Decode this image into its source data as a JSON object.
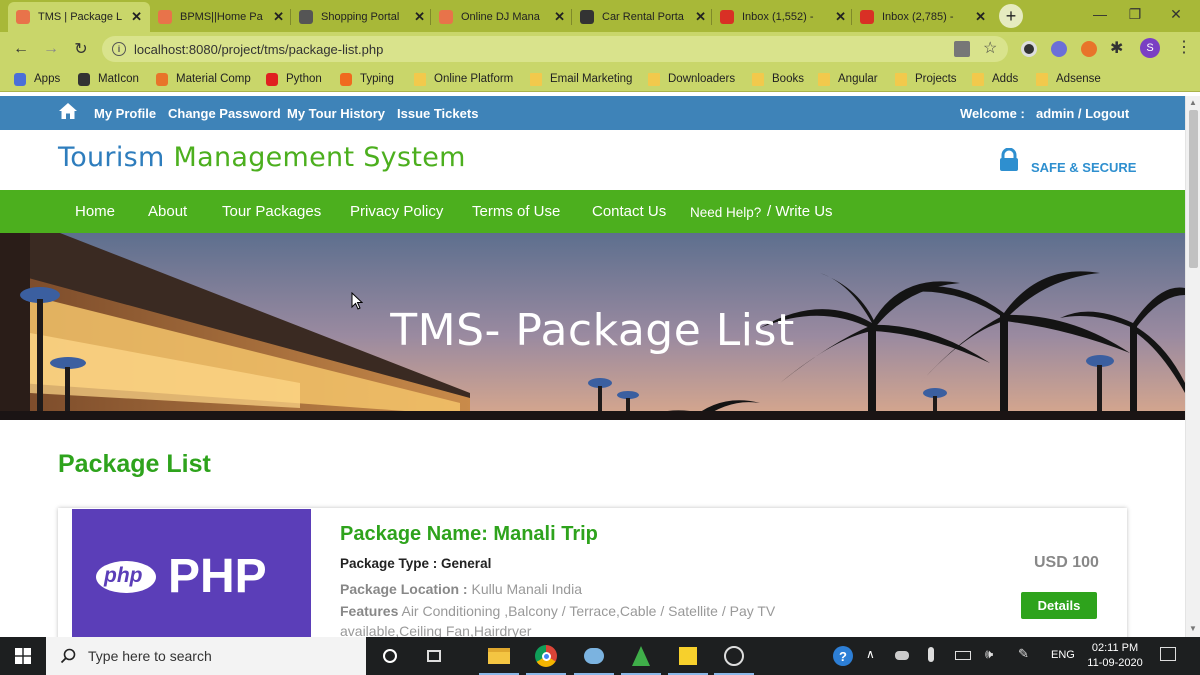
{
  "browser": {
    "tabs": [
      {
        "label": "TMS | Package L",
        "favicon_color": "#e8734a",
        "active": true
      },
      {
        "label": "BPMS||Home Pa",
        "favicon_color": "#e8734a",
        "active": false
      },
      {
        "label": "Shopping Portal",
        "favicon_color": "#555555",
        "active": false
      },
      {
        "label": "Online DJ Mana",
        "favicon_color": "#e8734a",
        "active": false
      },
      {
        "label": "Car Rental Porta",
        "favicon_color": "#333333",
        "active": false
      },
      {
        "label": "Inbox (1,552) -",
        "favicon_color": "#d93025",
        "active": false
      },
      {
        "label": "Inbox (2,785) -",
        "favicon_color": "#d93025",
        "active": false
      }
    ],
    "new_tab": "+",
    "url": "localhost:8080/project/tms/package-list.php",
    "profile_initial": "S",
    "bookmarks": [
      {
        "label": "Apps",
        "icon": "apps-grid-icon"
      },
      {
        "label": "MatIcon",
        "icon": "maticon-icon"
      },
      {
        "label": "Material Comp",
        "icon": "material-icon"
      },
      {
        "label": "Python",
        "icon": "youtube-icon"
      },
      {
        "label": "Typing",
        "icon": "typing-icon"
      },
      {
        "label": "Online Platform",
        "icon": "folder-icon"
      },
      {
        "label": "Email Marketing",
        "icon": "folder-icon"
      },
      {
        "label": "Downloaders",
        "icon": "folder-icon"
      },
      {
        "label": "Books",
        "icon": "folder-icon"
      },
      {
        "label": "Angular",
        "icon": "folder-icon"
      },
      {
        "label": "Projects",
        "icon": "folder-icon"
      },
      {
        "label": "Adds",
        "icon": "folder-icon"
      },
      {
        "label": "Adsense",
        "icon": "folder-icon"
      }
    ]
  },
  "site": {
    "topbar": {
      "links": [
        "My Profile",
        "Change Password",
        "My Tour History",
        "Issue Tickets"
      ],
      "welcome_label": "Welcome :",
      "user_link": "admin / Logout"
    },
    "brand_part1": "Tourism",
    "brand_part2": "Management System",
    "secure_label": "SAFE & SECURE",
    "nav": [
      "Home",
      "About",
      "Tour Packages",
      "Privacy Policy",
      "Terms of Use",
      "Contact Us"
    ],
    "help_label": "Need Help?",
    "write_us": "/ Write Us",
    "banner_title": "TMS- Package List",
    "section_heading": "Package List",
    "package": {
      "image_text": "PHP",
      "image_badge": "php",
      "name": "Package Name: Manali Trip",
      "type": "Package Type : General",
      "location_label": "Package Location :",
      "location": "Kullu Manali India",
      "features_label": "Features",
      "features": "Air Conditioning ,Balcony / Terrace,Cable / Satellite / Pay TV available,Ceiling Fan,Hairdryer",
      "price": "USD 100",
      "details_button": "Details"
    }
  },
  "taskbar": {
    "search_placeholder": "Type here to search",
    "language": "ENG",
    "time": "02:11 PM",
    "date": "11-09-2020"
  }
}
